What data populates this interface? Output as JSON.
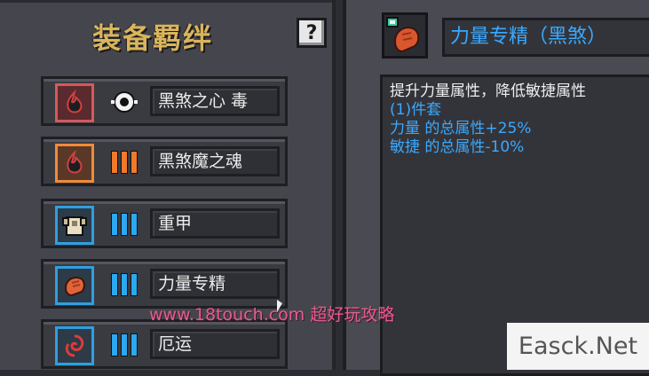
{
  "left": {
    "title": "装备羁绊",
    "help_label": "?",
    "sets": [
      {
        "name": "黑煞之心 毒",
        "frame_color": "#d45a5a",
        "icon": "black-flame-icon",
        "tier_icon": "skull-eye-icon"
      },
      {
        "name": "黑煞魔之魂",
        "frame_color": "#f08b3a",
        "icon": "black-flame-icon",
        "tier_icon": "orange-bars-icon"
      },
      {
        "name": "重甲",
        "frame_color": "#2f9fe0",
        "icon": "heavy-armor-icon",
        "tier_icon": "blue-bars-icon"
      },
      {
        "name": "力量专精",
        "frame_color": "#2f9fe0",
        "icon": "strength-fist-icon",
        "tier_icon": "blue-bars-icon"
      },
      {
        "name": "厄运",
        "frame_color": "#2f9fe0",
        "icon": "doom-swirl-icon",
        "tier_icon": "blue-bars-icon"
      }
    ]
  },
  "right": {
    "item_name": "力量专精（黑煞）",
    "item_icon": "strength-fist-icon",
    "description": [
      {
        "text": "提升力量属性，降低敏捷属性",
        "color": "#eeeeee"
      },
      {
        "text": "(1)件套",
        "color": "#3aa9ff"
      },
      {
        "text": "力量 的总属性+25%",
        "color": "#3aa9ff"
      },
      {
        "text": "敏捷 的总属性-10%",
        "color": "#3aa9ff"
      }
    ]
  },
  "watermarks": {
    "url": "www.18touch.com 超好玩攻略",
    "site": "Easck.Net"
  }
}
